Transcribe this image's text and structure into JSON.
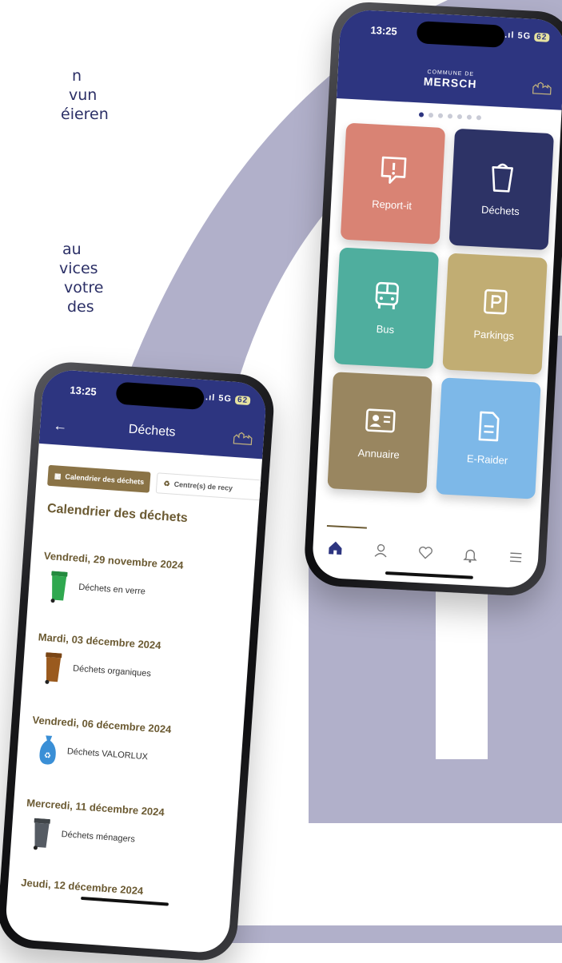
{
  "marketing_text": {
    "block1": [
      "n",
      "vun",
      "éieren"
    ],
    "block2": [
      "au",
      "vices",
      "votre",
      "des"
    ]
  },
  "right_phone": {
    "status": {
      "time": "13:25",
      "signal": "5G",
      "battery": "62"
    },
    "header": {
      "kicker": "COMMUNE DE",
      "title": "MERSCH"
    },
    "tiles": [
      {
        "label": "Report-it",
        "icon": "report-alert-icon",
        "color": "#d98374"
      },
      {
        "label": "Déchets",
        "icon": "trash-bin-icon",
        "color": "#2d3366"
      },
      {
        "label": "Bus",
        "icon": "bus-icon",
        "color": "#4fae9e"
      },
      {
        "label": "Parkings",
        "icon": "parking-icon",
        "color": "#c1ad73"
      },
      {
        "label": "Annuaire",
        "icon": "contact-card-icon",
        "color": "#998660"
      },
      {
        "label": "E-Raider",
        "icon": "document-icon",
        "color": "#7db8e8"
      }
    ],
    "nav": [
      "home-icon",
      "profile-icon",
      "favorites-icon",
      "notifications-icon",
      "menu-icon"
    ]
  },
  "left_phone": {
    "status": {
      "time": "13:25",
      "signal": "5G",
      "battery": "62"
    },
    "header": {
      "title": "Déchets"
    },
    "tabs": [
      {
        "label": "Calendrier des déchets",
        "active": true
      },
      {
        "label": "Centre(s) de recy",
        "active": false
      }
    ],
    "section_title": "Calendrier des déchets",
    "entries": [
      {
        "date": "Vendredi, 29 novembre 2024",
        "type": "Déchets en verre",
        "bin_color": "#2fa84f"
      },
      {
        "date": "Mardi, 03 décembre 2024",
        "type": "Déchets organiques",
        "bin_color": "#9a5a1e"
      },
      {
        "date": "Vendredi, 06 décembre 2024",
        "type": "Déchets VALORLUX",
        "bin_color": "#3a8fd6"
      },
      {
        "date": "Mercredi, 11 décembre 2024",
        "type": "Déchets ménagers",
        "bin_color": "#555b63"
      },
      {
        "date": "Jeudi, 12 décembre 2024",
        "type": "",
        "bin_color": ""
      }
    ]
  },
  "colors": {
    "brand_navy": "#2d3580",
    "decor": "#b1b0ca",
    "accent_brown": "#6b5a32"
  }
}
